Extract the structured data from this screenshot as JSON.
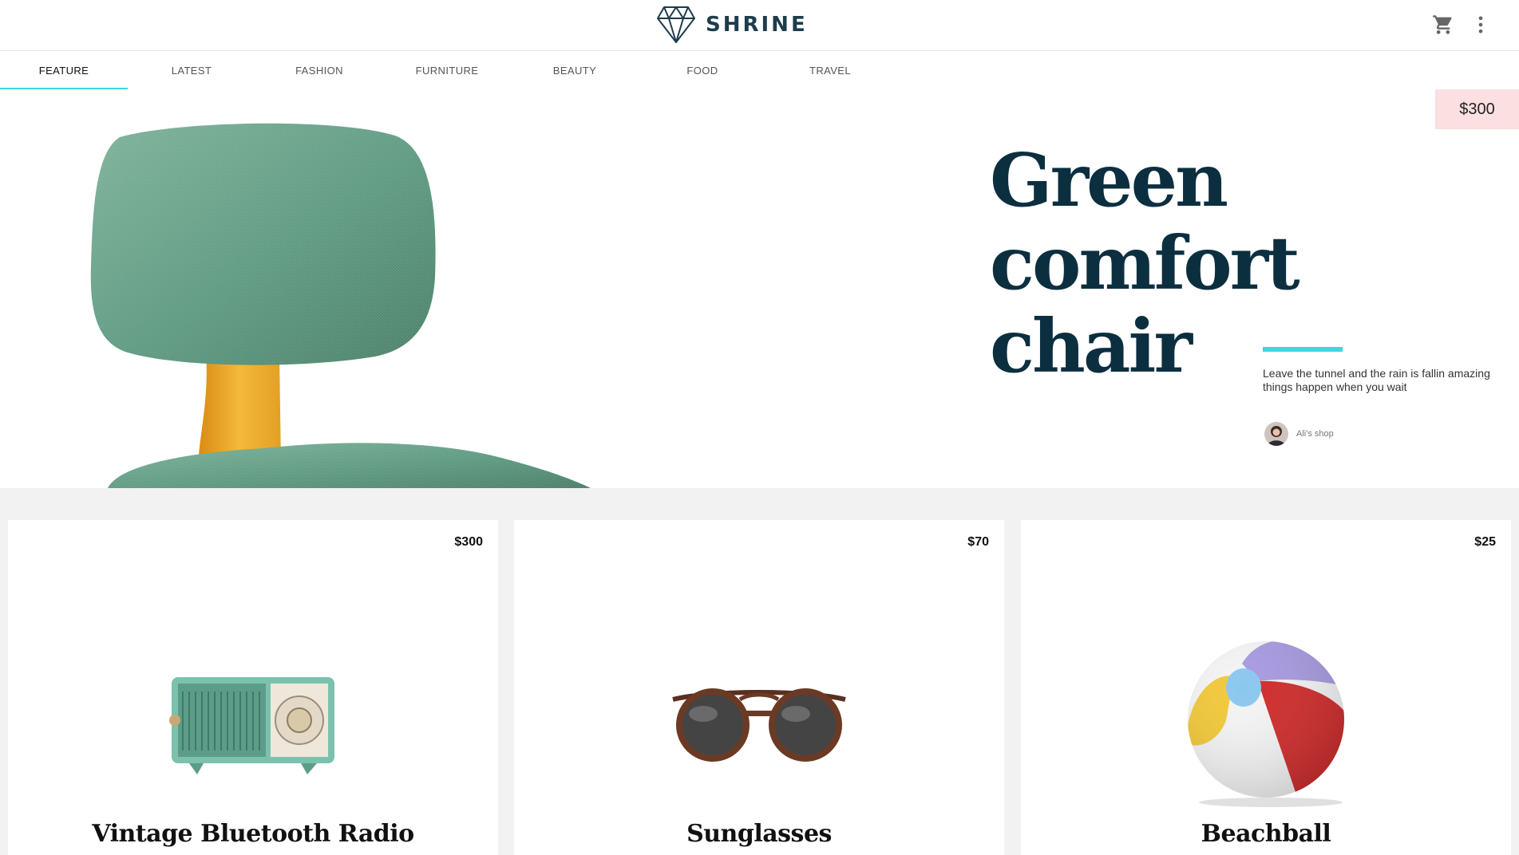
{
  "header": {
    "brand": "SHRINE",
    "icons": {
      "logo": "diamond-icon",
      "cart": "shopping-cart-icon",
      "menu": "more-vert-icon"
    }
  },
  "tabs": [
    {
      "label": "FEATURE",
      "active": true
    },
    {
      "label": "LATEST"
    },
    {
      "label": "FASHION"
    },
    {
      "label": "FURNITURE"
    },
    {
      "label": "BEAUTY"
    },
    {
      "label": "FOOD"
    },
    {
      "label": "TRAVEL"
    }
  ],
  "hero": {
    "price": "$300",
    "title": "Green comfort chair",
    "description": "Leave the tunnel and the rain is fallin amazing things happen when you wait",
    "shop": "Ali's shop"
  },
  "products": [
    {
      "price": "$300",
      "title": "Vintage Bluetooth Radio"
    },
    {
      "price": "$70",
      "title": "Sunglasses"
    },
    {
      "price": "$25",
      "title": "Beachball"
    }
  ],
  "colors": {
    "accent": "#3ed6e0",
    "hero_price_bg": "#fbdfe1",
    "title_navy": "#0c2f40",
    "page_bg": "#f2f2f2"
  }
}
